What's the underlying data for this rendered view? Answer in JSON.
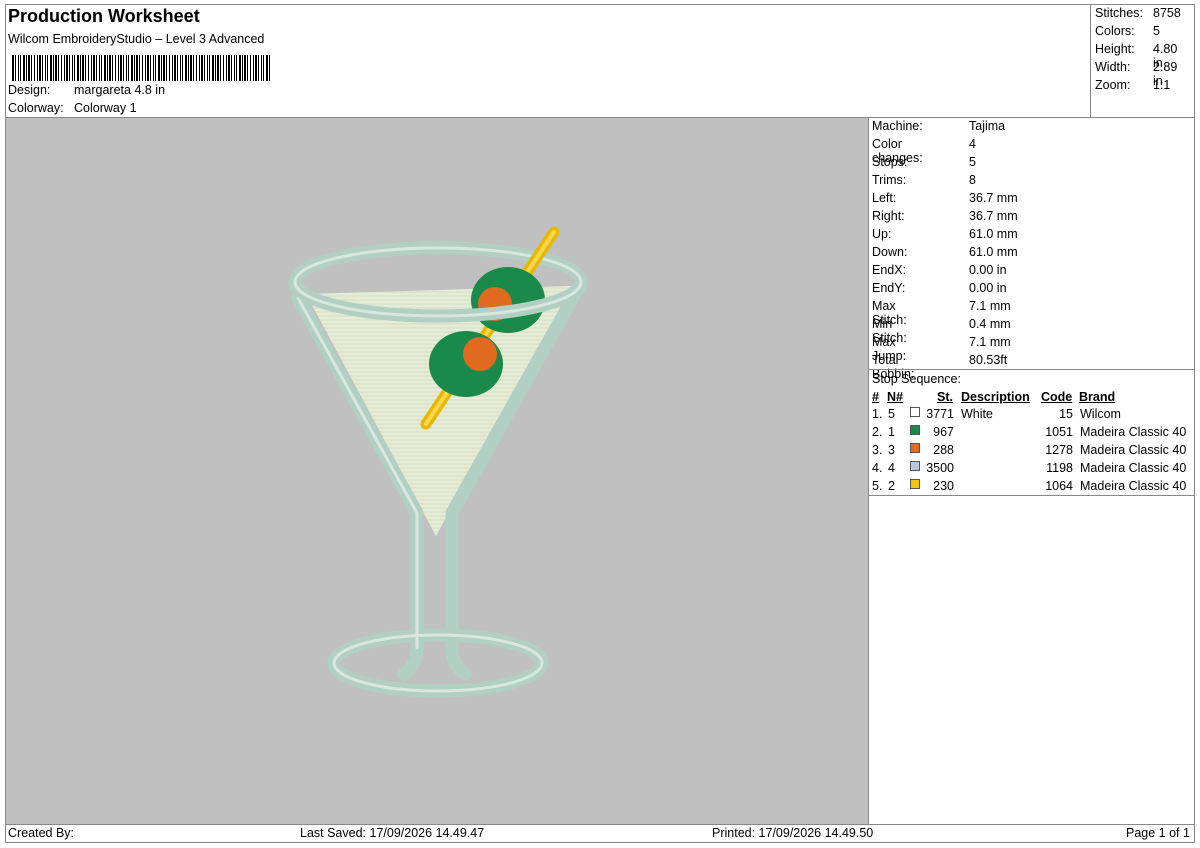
{
  "header": {
    "title": "Production Worksheet",
    "subtitle": "Wilcom EmbroideryStudio – Level 3 Advanced",
    "design_label": "Design:",
    "design_value": "margareta 4.8 in",
    "colorway_label": "Colorway:",
    "colorway_value": "Colorway 1"
  },
  "summary": {
    "stitches_label": "Stitches:",
    "stitches": "8758",
    "colors_label": "Colors:",
    "colors": "5",
    "height_label": "Height:",
    "height": "4.80 in",
    "width_label": "Width:",
    "width": "2.89 in",
    "zoom_label": "Zoom:",
    "zoom": "1:1"
  },
  "specs": [
    {
      "k": "Machine:",
      "v": "Tajima"
    },
    {
      "k": "Color changes:",
      "v": "4"
    },
    {
      "k": "Stops:",
      "v": "5"
    },
    {
      "k": "Trims:",
      "v": "8"
    },
    {
      "k": "Left:",
      "v": "36.7 mm"
    },
    {
      "k": "Right:",
      "v": "36.7 mm"
    },
    {
      "k": "Up:",
      "v": "61.0 mm"
    },
    {
      "k": "Down:",
      "v": "61.0 mm"
    },
    {
      "k": "EndX:",
      "v": "0.00 in"
    },
    {
      "k": "EndY:",
      "v": "0.00 in"
    },
    {
      "k": "Max Stitch:",
      "v": "7.1 mm"
    },
    {
      "k": "Min Stitch:",
      "v": "0.4 mm"
    },
    {
      "k": "Max Jump:",
      "v": "7.1 mm"
    },
    {
      "k": "Total Bobbin:",
      "v": "80.53ft"
    }
  ],
  "stop_sequence": {
    "title": "Stop Sequence:",
    "headers": {
      "num": "#",
      "n": "N#",
      "st": "St.",
      "desc": "Description",
      "code": "Code",
      "brand": "Brand"
    },
    "rows": [
      {
        "num": "1.",
        "n": "5",
        "color": "#ffffff",
        "st": "3771",
        "desc": "White",
        "code": "15",
        "brand": "Wilcom"
      },
      {
        "num": "2.",
        "n": "1",
        "color": "#1a8a4a",
        "st": "967",
        "desc": "",
        "code": "1051",
        "brand": "Madeira Classic 40"
      },
      {
        "num": "3.",
        "n": "3",
        "color": "#e06a20",
        "st": "288",
        "desc": "",
        "code": "1278",
        "brand": "Madeira Classic 40"
      },
      {
        "num": "4.",
        "n": "4",
        "color": "#b8c8dc",
        "st": "3500",
        "desc": "",
        "code": "1198",
        "brand": "Madeira Classic 40"
      },
      {
        "num": "5.",
        "n": "2",
        "color": "#f5c010",
        "st": "230",
        "desc": "",
        "code": "1064",
        "brand": "Madeira Classic 40"
      }
    ]
  },
  "footer": {
    "created_by": "Created By:",
    "last_saved": "Last Saved: 17/09/2026 14.49.47",
    "printed": "Printed: 17/09/2026 14.49.50",
    "page": "Page 1 of 1"
  },
  "design_colors": {
    "glass": "#b7d3c8",
    "liquid": "#e2e8d2",
    "olive": "#1a8a4a",
    "pimento": "#e06a20",
    "pick": "#f5c010",
    "canvas_bg": "#c0c0c0"
  }
}
